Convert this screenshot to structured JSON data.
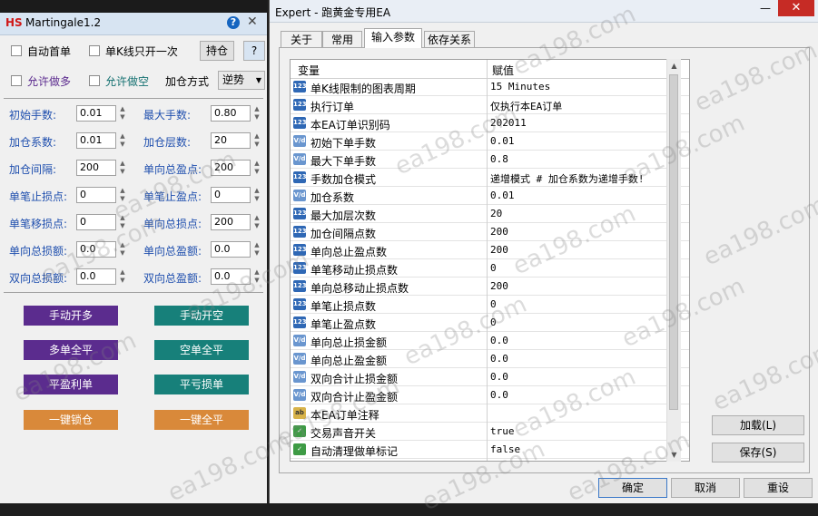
{
  "left_panel": {
    "brand": "HS",
    "title": "Martingale",
    "version": "1.2",
    "checkboxes": {
      "auto_first": "自动首单",
      "single_k": "单K线只开一次",
      "allow_long": "允许做多",
      "allow_short": "允许做空"
    },
    "hold_button": "持仓",
    "help_button": "?",
    "add_mode_label": "加仓方式",
    "add_mode_value": "逆势",
    "fields": [
      {
        "label": "初始手数:",
        "value": "0.01"
      },
      {
        "label": "最大手数:",
        "value": "0.80"
      },
      {
        "label": "加仓系数:",
        "value": "0.01"
      },
      {
        "label": "加仓层数:",
        "value": "20"
      },
      {
        "label": "加仓间隔:",
        "value": "200"
      },
      {
        "label": "单向总盈点:",
        "value": "200"
      },
      {
        "label": "单笔止损点:",
        "value": "0"
      },
      {
        "label": "单笔止盈点:",
        "value": "0"
      },
      {
        "label": "单笔移损点:",
        "value": "0"
      },
      {
        "label": "单向总损点:",
        "value": "200"
      },
      {
        "label": "单向总损额:",
        "value": "0.0"
      },
      {
        "label": "单向总盈额:",
        "value": "0.0"
      },
      {
        "label": "双向总损额:",
        "value": "0.0"
      },
      {
        "label": "双向总盈额:",
        "value": "0.0"
      }
    ],
    "actions": {
      "manual_long": "手动开多",
      "manual_short": "手动开空",
      "close_all_long": "多单全平",
      "close_all_short": "空单全平",
      "close_profit": "平盈利单",
      "close_loss": "平亏损单",
      "lock": "一键锁仓",
      "close_all": "一键全平"
    }
  },
  "dialog": {
    "title": "Expert - 跑黄金专用EA",
    "minimize": "—",
    "close": "✕",
    "tabs": [
      "关于",
      "常用",
      "输入参数",
      "依存关系"
    ],
    "active_tab": "输入参数",
    "grid_headers": {
      "variable": "变量",
      "value": "赋值"
    },
    "params": [
      {
        "icon": "123",
        "name": "单K线限制的图表周期",
        "value": "15 Minutes"
      },
      {
        "icon": "123",
        "name": "执行订单",
        "value": "仅执行本EA订单"
      },
      {
        "icon": "123",
        "name": "本EA订单识别码",
        "value": "202011"
      },
      {
        "icon": "Vd",
        "name": "初始下单手数",
        "value": "0.01"
      },
      {
        "icon": "Vd",
        "name": "最大下单手数",
        "value": "0.8"
      },
      {
        "icon": "123",
        "name": "手数加仓模式",
        "value": "递增模式 # 加仓系数为递增手数!"
      },
      {
        "icon": "Vd",
        "name": "加仓系数",
        "value": "0.01"
      },
      {
        "icon": "123",
        "name": "最大加层次数",
        "value": "20"
      },
      {
        "icon": "123",
        "name": "加仓间隔点数",
        "value": "200"
      },
      {
        "icon": "123",
        "name": "单向总止盈点数",
        "value": "200"
      },
      {
        "icon": "123",
        "name": "单笔移动止损点数",
        "value": "0"
      },
      {
        "icon": "123",
        "name": "单向总移动止损点数",
        "value": "200"
      },
      {
        "icon": "123",
        "name": "单笔止损点数",
        "value": "0"
      },
      {
        "icon": "123",
        "name": "单笔止盈点数",
        "value": "0"
      },
      {
        "icon": "Vd",
        "name": "单向总止损金额",
        "value": "0.0"
      },
      {
        "icon": "Vd",
        "name": "单向总止盈金额",
        "value": "0.0"
      },
      {
        "icon": "Vd",
        "name": "双向合计止损金额",
        "value": "0.0"
      },
      {
        "icon": "Vd",
        "name": "双向合计止盈金额",
        "value": "0.0"
      },
      {
        "icon": "ab",
        "name": "本EA订单注释",
        "value": ""
      },
      {
        "icon": "bool",
        "name": "交易声音开关",
        "value": "true"
      },
      {
        "icon": "bool",
        "name": "自动清理做单标记",
        "value": "false"
      }
    ],
    "side_buttons": {
      "load": "加载(L)",
      "save": "保存(S)"
    },
    "bottom_buttons": {
      "ok": "确定",
      "cancel": "取消",
      "reset": "重设"
    }
  },
  "watermark": "ea198.com",
  "colors": {
    "purple_button": "#5b2c8e",
    "teal_button": "#17807a",
    "orange_button": "#d9893a",
    "close_red": "#c62b25"
  }
}
